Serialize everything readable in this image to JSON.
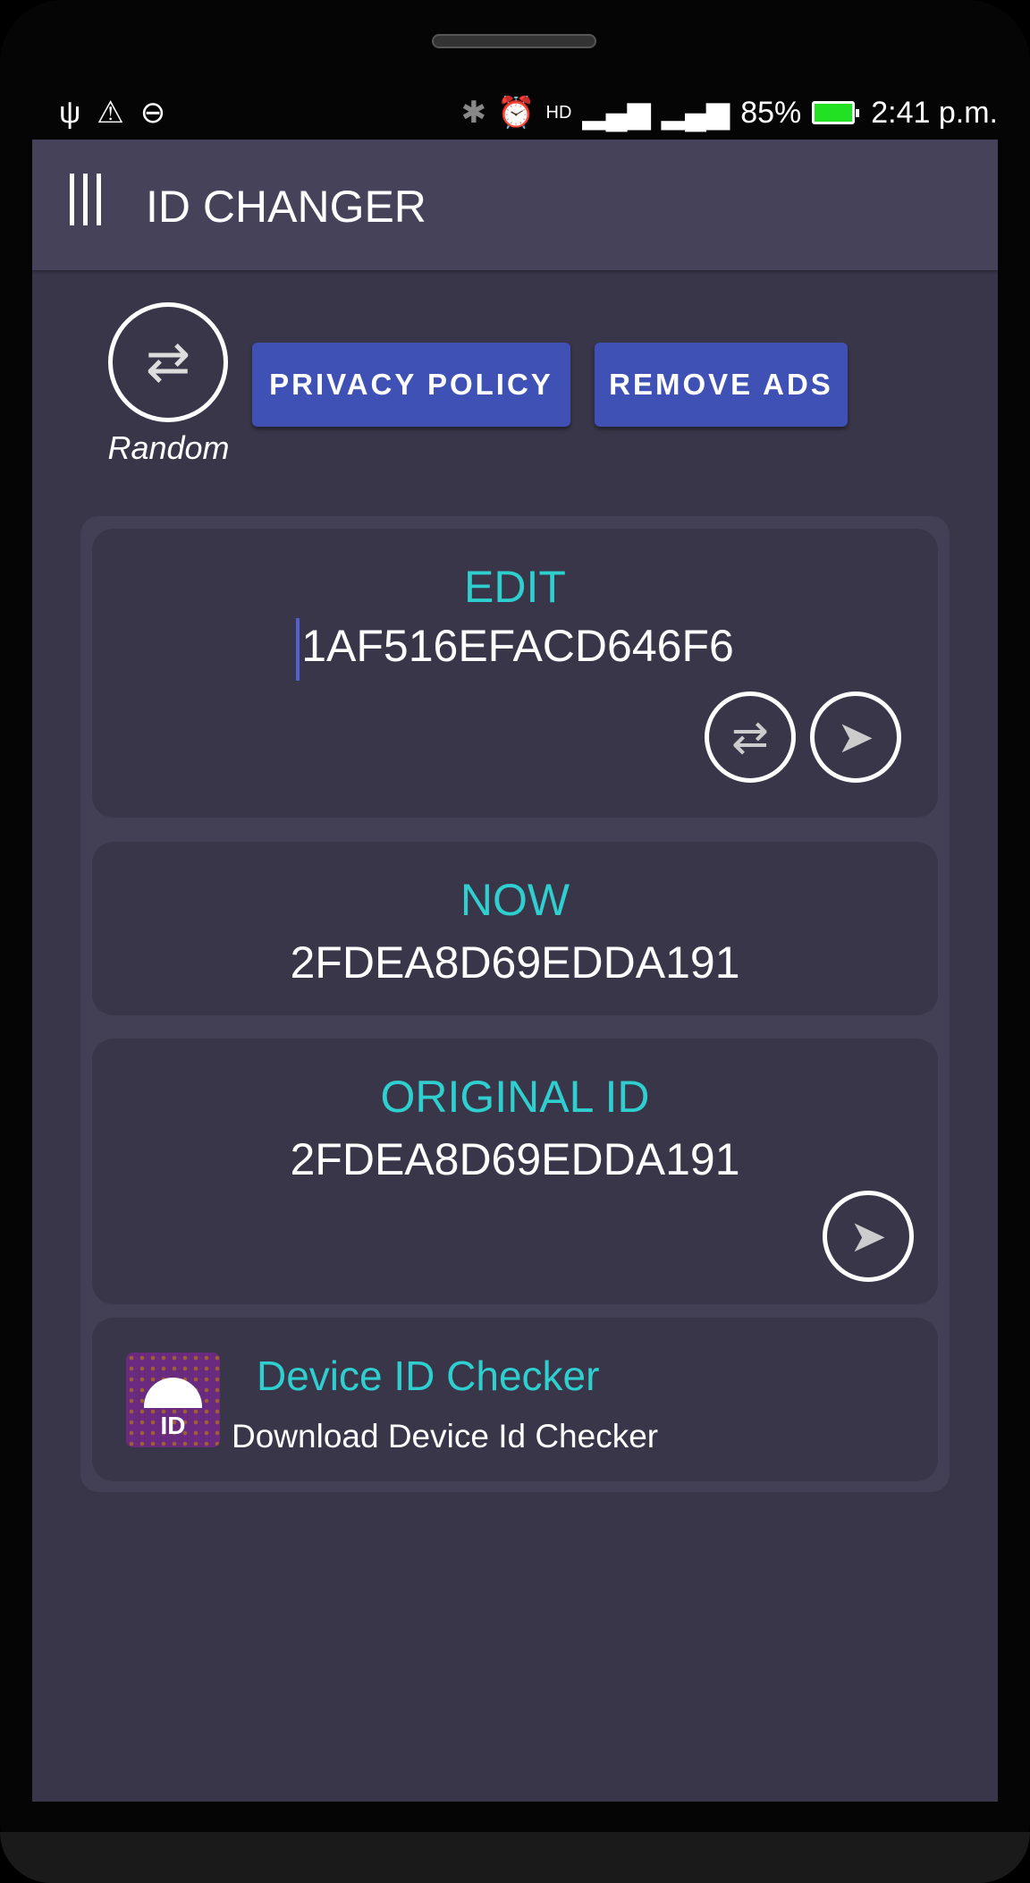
{
  "status_bar": {
    "battery": "85%",
    "time": "2:41 p.m.",
    "battery_level": 0.85
  },
  "app_bar": {
    "title": "ID CHANGER"
  },
  "actions": {
    "random_label": "Random",
    "privacy_policy": "PRIVACY POLICY",
    "remove_ads": "REMOVE ADS"
  },
  "edit_card": {
    "label": "EDIT",
    "value": "1AF516EFACD646F6"
  },
  "now_card": {
    "label": "NOW",
    "value": "2FDEA8D69EDDA191"
  },
  "original_card": {
    "label": "ORIGINAL ID",
    "value": "2FDEA8D69EDDA191"
  },
  "promo": {
    "title": "Device ID Checker",
    "subtitle": "Download Device Id Checker",
    "icon_text": "ID"
  },
  "colors": {
    "accent": "#2fcfcf",
    "button": "#3f51b5",
    "background": "#393649",
    "app_bar": "#46425a"
  }
}
